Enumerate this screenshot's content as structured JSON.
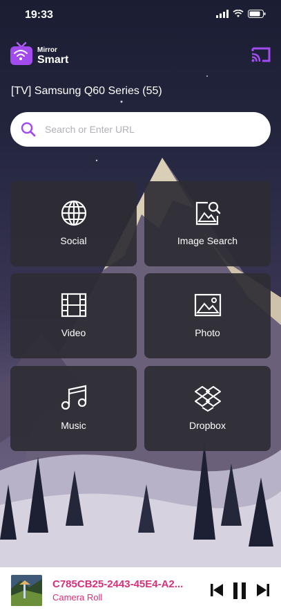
{
  "status_bar": {
    "time": "19:33"
  },
  "app": {
    "brand_top": "Mirror",
    "brand_bottom": "Smart"
  },
  "device": {
    "name": "[TV] Samsung Q60 Series (55)"
  },
  "search": {
    "placeholder": "Search or Enter URL",
    "value": ""
  },
  "tiles": [
    {
      "label": "Social",
      "icon": "globe-icon"
    },
    {
      "label": "Image Search",
      "icon": "image-search-icon"
    },
    {
      "label": "Video",
      "icon": "film-icon"
    },
    {
      "label": "Photo",
      "icon": "photo-icon"
    },
    {
      "label": "Music",
      "icon": "music-icon"
    },
    {
      "label": "Dropbox",
      "icon": "dropbox-icon"
    }
  ],
  "player": {
    "title": "C785CB25-2443-45E4-A2...",
    "subtitle": "Camera Roll"
  },
  "colors": {
    "accent": "#a24cf0",
    "player_text": "#d6307a"
  }
}
